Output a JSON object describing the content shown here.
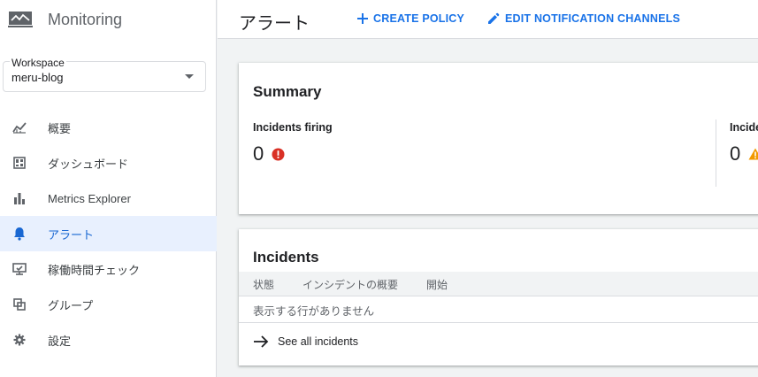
{
  "app": {
    "title": "Monitoring",
    "logo_icon": "monitor-icon"
  },
  "workspace": {
    "label": "Workspace",
    "value": "meru-blog"
  },
  "sidebar": {
    "items": [
      {
        "label": "概要",
        "icon": "chart-line-icon",
        "active": false
      },
      {
        "label": "ダッシュボード",
        "icon": "dashboard-icon",
        "active": false
      },
      {
        "label": "Metrics Explorer",
        "icon": "bar-chart-icon",
        "active": false
      },
      {
        "label": "アラート",
        "icon": "bell-icon",
        "active": true
      },
      {
        "label": "稼働時間チェック",
        "icon": "monitor-check-icon",
        "active": false
      },
      {
        "label": "グループ",
        "icon": "group-icon",
        "active": false
      },
      {
        "label": "設定",
        "icon": "gear-icon",
        "active": false
      }
    ]
  },
  "header": {
    "title": "アラート",
    "create_policy": "CREATE POLICY",
    "edit_channels": "EDIT NOTIFICATION CHANNELS"
  },
  "summary": {
    "title": "Summary",
    "firing_label": "Incidents firing",
    "firing_value": "0",
    "second_label": "Incide",
    "second_value": "0"
  },
  "incidents": {
    "title": "Incidents",
    "columns": [
      "状態",
      "インシデントの概要",
      "開始"
    ],
    "empty_text": "表示する行がありません",
    "see_all": "See all incidents"
  },
  "colors": {
    "accent": "#1a73e8",
    "error": "#d93025",
    "warning": "#f29900",
    "active_bg": "#e8f0fe"
  }
}
